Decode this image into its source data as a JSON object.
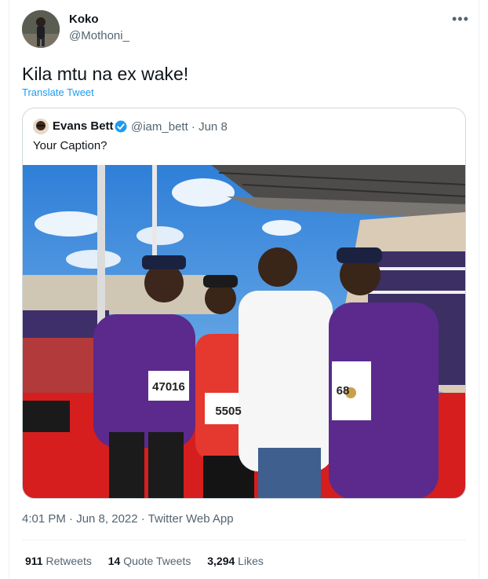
{
  "author": {
    "display_name": "Koko",
    "handle": "@Mothoni_"
  },
  "more_icon": "more-horizontal-icon",
  "tweet_text": "Kila mtu na ex wake!",
  "translate_label": "Translate Tweet",
  "quoted_tweet": {
    "display_name": "Evans Bett",
    "verified_icon": "verified-badge-icon",
    "meta": "@iam_bett · Jun 8",
    "text": "Your Caption?",
    "bibs": [
      "47016",
      "5505",
      "68"
    ]
  },
  "timestamp": "4:01 PM · Jun 8, 2022 · Twitter Web App",
  "stats": {
    "retweets_count": "911",
    "retweets_label": "Retweets",
    "quotes_count": "14",
    "quotes_label": "Quote Tweets",
    "likes_count": "3,294",
    "likes_label": "Likes"
  },
  "colors": {
    "accent": "#1d9bf0",
    "secondary_text": "#536471",
    "border": "#cfd9de"
  }
}
